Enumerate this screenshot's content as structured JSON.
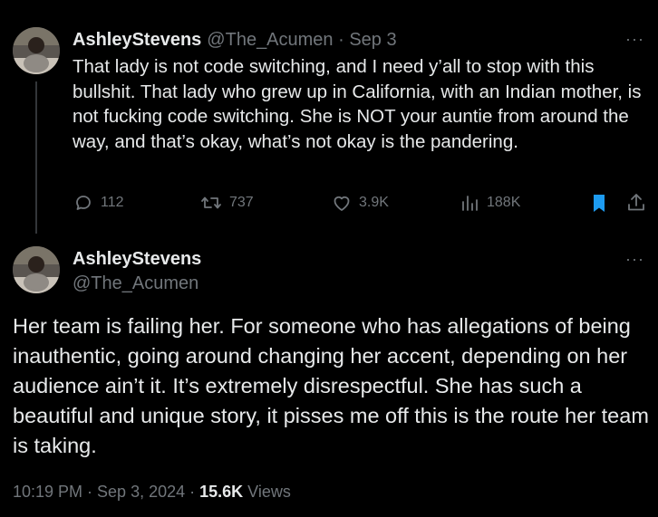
{
  "parent_tweet": {
    "display_name": "AshleyStevens",
    "handle": "@The_Acumen",
    "separator": " · ",
    "date": "Sep 3",
    "text": "That lady is not code switching, and I need y’all to stop with this bullshit. That lady who grew up in California, with an Indian mother, is not fucking code switching. She is NOT your auntie from around the way, and that’s okay, what’s not okay is the pandering.",
    "more_label": "···",
    "actions": {
      "replies": "112",
      "reposts": "737",
      "likes": "3.9K",
      "views": "188K"
    }
  },
  "reply_tweet": {
    "display_name": "AshleyStevens",
    "handle": "@The_Acumen",
    "more_label": "···",
    "text": "Her team is failing her. For someone who has allegations of being inauthentic, going around changing her accent, depending on her audience ain’t it. It’s extremely disrespectful. She has such a beautiful and unique story, it pisses me off this is the route her team is taking.",
    "timestamp": "10:19 PM · Sep 3, 2024 · ",
    "views_count": "15.6K",
    "views_label": " Views"
  },
  "colors": {
    "background": "#000000",
    "text": "#e7e9ea",
    "muted": "#71767b",
    "bookmark_active": "#1d9bf0"
  },
  "icons": [
    "reply-icon",
    "repost-icon",
    "like-icon",
    "views-icon",
    "bookmark-icon",
    "share-icon",
    "more-icon"
  ]
}
